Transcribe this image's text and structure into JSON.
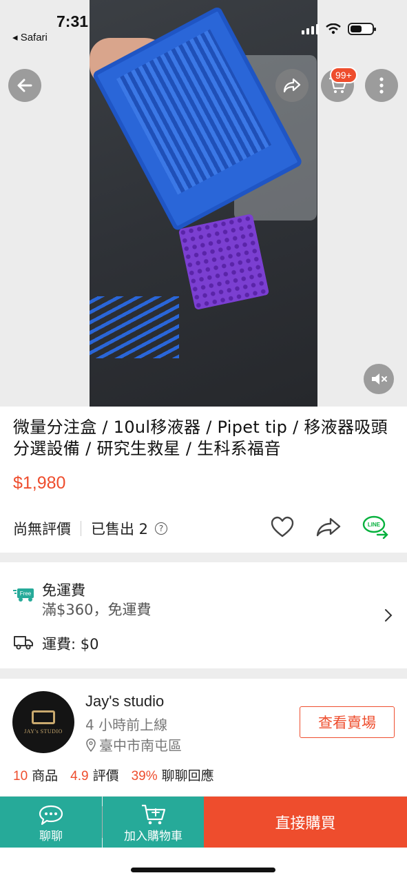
{
  "status_bar": {
    "time": "7:31",
    "back_app": "◂ Safari"
  },
  "media": {
    "cart_badge": "99+"
  },
  "product": {
    "title": "微量分注盒 / 10ul移液器 / Pipet tip / 移液器吸頭分選設備 / 研究生救星 / 生科系福音",
    "price": "$1,980",
    "rating_text": "尚無評價",
    "sold_text": "已售出 2",
    "line_label": "LINE"
  },
  "shipping": {
    "free_badge": "Free",
    "title": "免運費",
    "subtitle": "滿$360，免運費",
    "fee": "運費: $0"
  },
  "shop": {
    "logo_text": "JAY's STUDIO",
    "name": "Jay's studio",
    "online_status": "4 小時前上線",
    "location": "臺中市南屯區",
    "view_button": "查看賣場",
    "stats": [
      {
        "value": "10",
        "label": "商品"
      },
      {
        "value": "4.9",
        "label": "評價"
      },
      {
        "value": "39%",
        "label": "聊聊回應"
      }
    ]
  },
  "bottom_bar": {
    "chat_label": "聊聊",
    "cart_label": "加入購物車",
    "buy_label": "直接購買"
  },
  "colors": {
    "brand": "#ee4d2d",
    "teal": "#26aa99",
    "line_green": "#06b13d"
  }
}
